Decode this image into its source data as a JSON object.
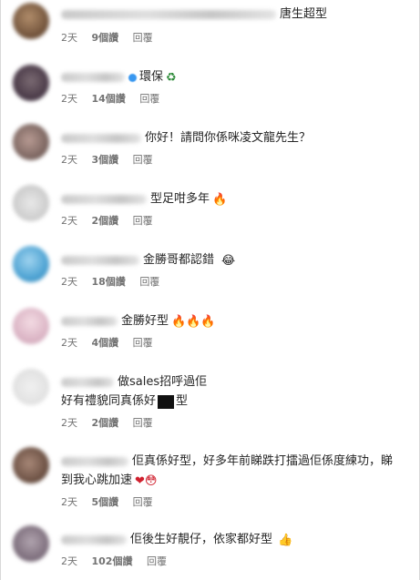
{
  "colors": {
    "text": "#262626",
    "meta": "#737373",
    "verified": "#3897f0"
  },
  "comments": [
    {
      "text": "唐生超型",
      "emoji": "",
      "time": "2天",
      "likes": "9個讚",
      "reply": "回覆"
    },
    {
      "text": "環保",
      "emoji": "♻",
      "time": "2天",
      "likes": "14個讚",
      "reply": "回覆"
    },
    {
      "text": "你好！請問你係咪凌文龍先生？",
      "emoji": "",
      "time": "2天",
      "likes": "3個讚",
      "reply": "回覆"
    },
    {
      "text": "型足咁多年",
      "emoji": "🔥",
      "time": "2天",
      "likes": "2個讚",
      "reply": "回覆"
    },
    {
      "text": "金勝哥都認錯",
      "emoji": "😂",
      "time": "2天",
      "likes": "18個讚",
      "reply": "回覆"
    },
    {
      "text": "金勝好型",
      "emoji": "🔥🔥🔥",
      "time": "2天",
      "likes": "4個讚",
      "reply": "回覆"
    },
    {
      "text": "做sales招呼過佢",
      "text2a": "好有禮貌同真係好",
      "text2b": "型",
      "time": "2天",
      "likes": "2個讚",
      "reply": "回覆"
    },
    {
      "text": "佢真係好型，好多年前睇跌打擂過佢係度練功，睇",
      "text2": "到我心跳加速",
      "emoji2": "❤😳",
      "time": "2天",
      "likes": "5個讚",
      "reply": "回覆"
    },
    {
      "text": "佢後生好靚仔，依家都好型",
      "emoji": "👍",
      "time": "2天",
      "likes": "102個讚",
      "reply": "回覆"
    }
  ]
}
